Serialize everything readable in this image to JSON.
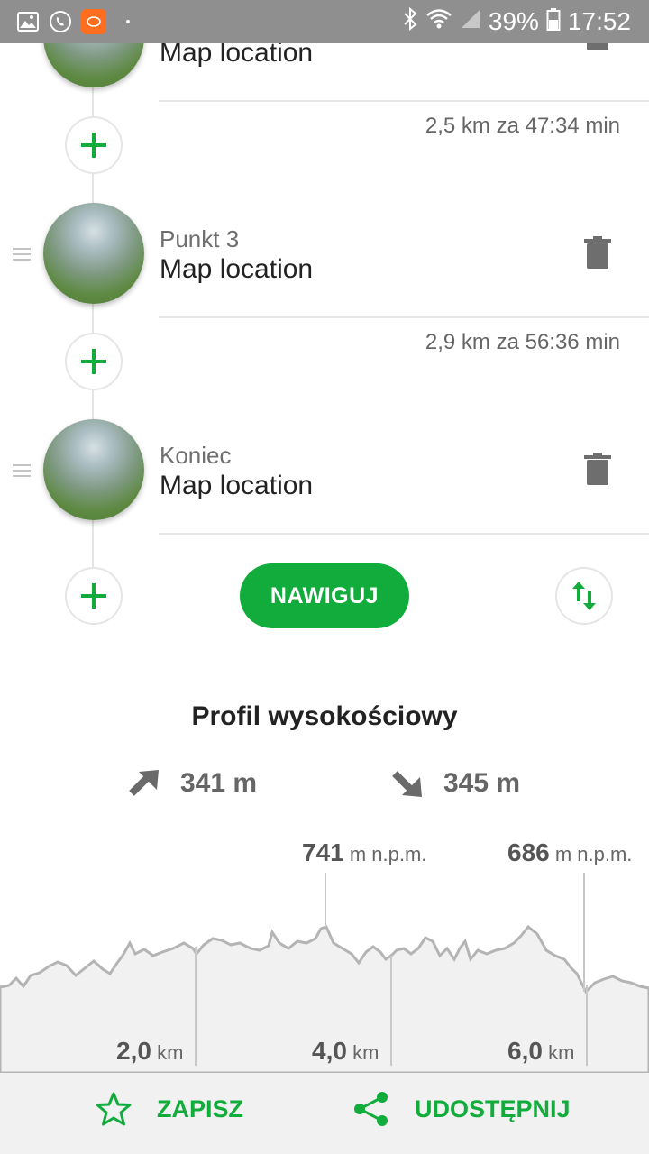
{
  "status_bar": {
    "battery": "39%",
    "time": "17:52"
  },
  "waypoints": [
    {
      "label": "",
      "title": "Map location"
    },
    {
      "label": "Punkt 3",
      "title": "Map location"
    },
    {
      "label": "Koniec",
      "title": "Map location"
    }
  ],
  "segments": [
    "2,5 km za 47:34 min",
    "2,9 km za 56:36 min"
  ],
  "navigate_label": "NAWIGUJ",
  "profile": {
    "title": "Profil wysokościowy",
    "ascent": "341 m",
    "descent": "345 m",
    "peaks": [
      {
        "value": "741",
        "unit": "m n.p.m."
      },
      {
        "value": "686",
        "unit": "m n.p.m."
      }
    ],
    "km_marks": [
      {
        "value": "2,0",
        "unit": "km"
      },
      {
        "value": "4,0",
        "unit": "km"
      },
      {
        "value": "6,0",
        "unit": "km"
      }
    ]
  },
  "actions": {
    "save": "ZAPISZ",
    "share": "UDOSTĘPNIJ"
  },
  "colors": {
    "accent": "#12ac3c",
    "status_bar": "#8f8f8f",
    "chart_fill": "#f1f1f1",
    "chart_line": "#b4b4b4"
  },
  "icons": [
    "gallery-icon",
    "phone-icon",
    "app-icon",
    "bluetooth-icon",
    "wifi-icon",
    "signal-icon",
    "battery-icon",
    "trash-icon",
    "drag-handle-icon",
    "plus-icon",
    "swap-icon",
    "ascent-arrow-icon",
    "descent-arrow-icon",
    "star-icon",
    "share-icon"
  ]
}
